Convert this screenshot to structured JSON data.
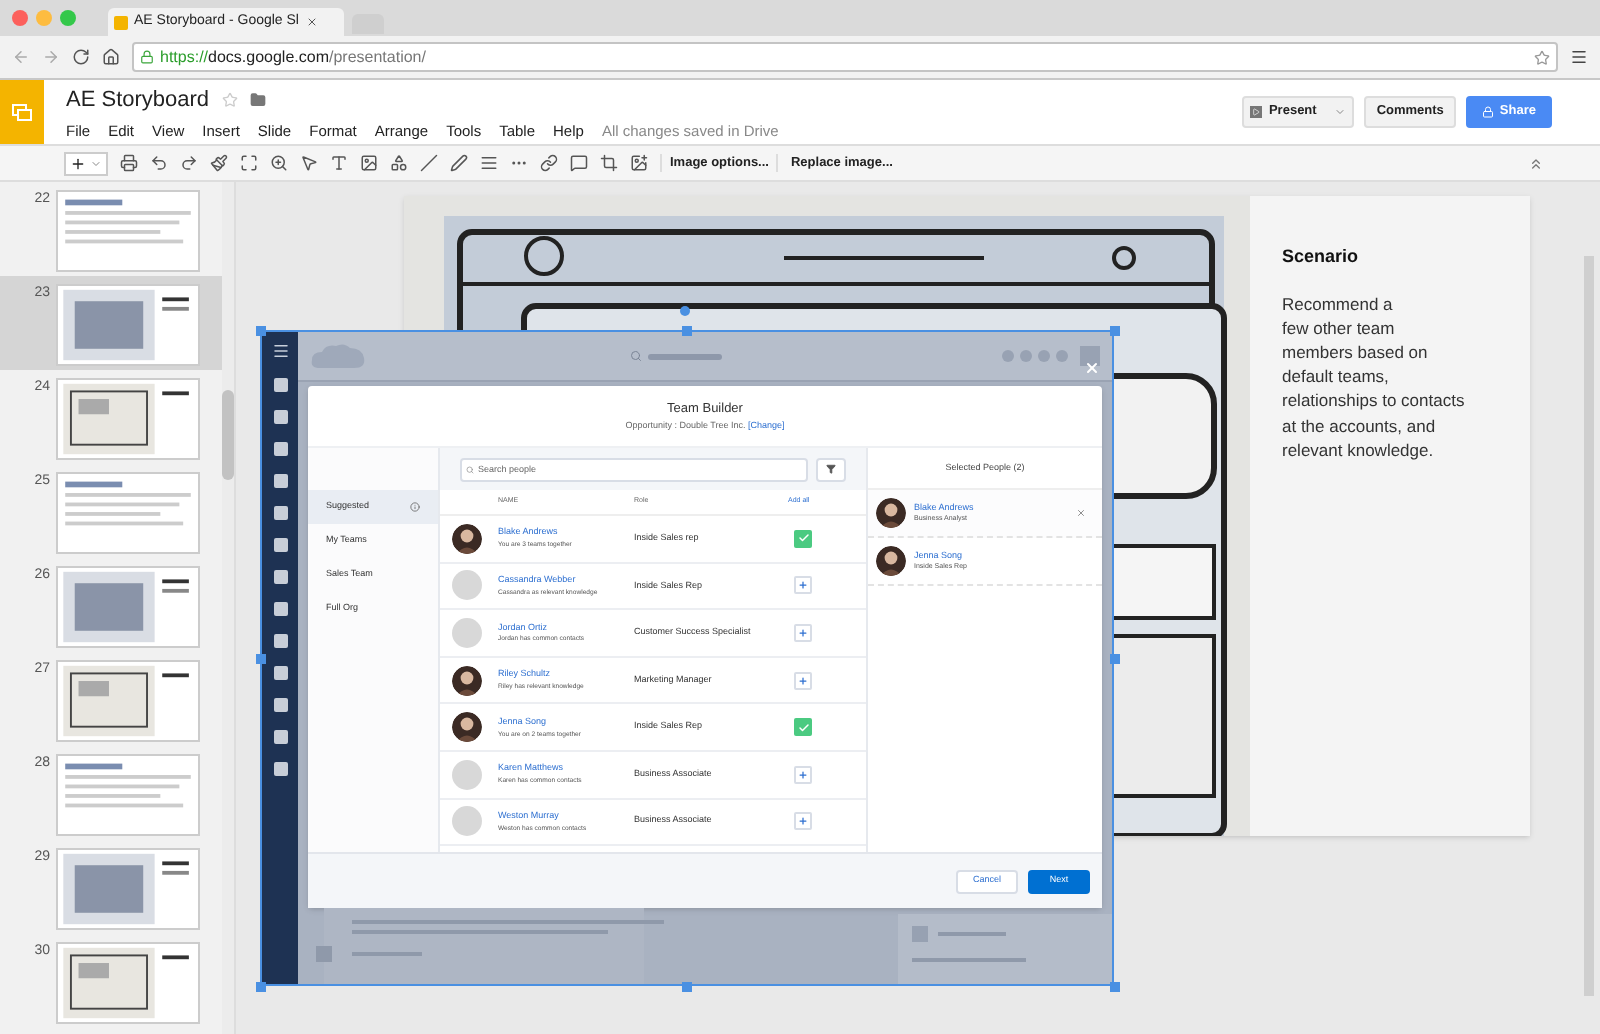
{
  "browser": {
    "tab_title": "AE Storyboard - Google Sl",
    "url_scheme": "https://",
    "url_host": "docs.google.com",
    "url_path": "/presentation/"
  },
  "document": {
    "title": "AE Storyboard",
    "menu": [
      "File",
      "Edit",
      "View",
      "Insert",
      "Slide",
      "Format",
      "Arrange",
      "Tools",
      "Table",
      "Help"
    ],
    "save_status": "All changes saved in Drive"
  },
  "header_buttons": {
    "present": "Present",
    "comments": "Comments",
    "share": "Share"
  },
  "toolbar": {
    "image_options": "Image options...",
    "replace_image": "Replace image..."
  },
  "slides": [
    {
      "number": "22",
      "selected": false
    },
    {
      "number": "23",
      "selected": true
    },
    {
      "number": "24",
      "selected": false
    },
    {
      "number": "25",
      "selected": false
    },
    {
      "number": "26",
      "selected": false
    },
    {
      "number": "27",
      "selected": false
    },
    {
      "number": "28",
      "selected": false
    },
    {
      "number": "29",
      "selected": false
    },
    {
      "number": "30",
      "selected": false
    }
  ],
  "slide": {
    "heading": "Scenario",
    "body_lines": [
      "Recommend a",
      "few other team",
      "members based on",
      "default teams,",
      "relationships to contacts",
      "at the accounts, and",
      "relevant knowledge."
    ]
  },
  "mockup": {
    "title": "Team Builder",
    "subtitle": "Opportunity : Double Tree Inc.",
    "change_link": "[Change]",
    "nav": [
      {
        "label": "Suggested",
        "selected": true
      },
      {
        "label": "My Teams",
        "selected": false
      },
      {
        "label": "Sales Team",
        "selected": false
      },
      {
        "label": "Full Org",
        "selected": false
      }
    ],
    "search_placeholder": "Search people",
    "columns": [
      "NAME",
      "Role",
      "Add all"
    ],
    "people": [
      {
        "name": "Blake Andrews",
        "note": "You are 3 teams together",
        "role": "Inside Sales rep",
        "added": true
      },
      {
        "name": "Cassandra Webber",
        "note": "Cassandra as relevant knowledge",
        "role": "Inside Sales Rep",
        "added": false,
        "kind": "placeholder"
      },
      {
        "name": "Jordan Ortiz",
        "note": "Jordan has common contacts",
        "role": "Customer Success Specialist",
        "added": false,
        "kind": "placeholder"
      },
      {
        "name": "Riley Schultz",
        "note": "Riley has relevant knowledge",
        "role": "Marketing Manager",
        "added": false
      },
      {
        "name": "Jenna Song",
        "note": "You are on 2 teams together",
        "role": "Inside Sales Rep",
        "added": true
      },
      {
        "name": "Karen Matthews",
        "note": "Karen has common contacts",
        "role": "Business Associate",
        "added": false,
        "kind": "placeholder"
      },
      {
        "name": "Weston Murray",
        "note": "Weston has common contacts",
        "role": "Business Associate",
        "added": false,
        "kind": "placeholder"
      }
    ],
    "selected_title": "Selected People (2)",
    "selected_people": [
      {
        "name": "Blake Andrews",
        "role": "Business Analyst",
        "hovered": true
      },
      {
        "name": "Jenna Song",
        "role": "Inside Sales Rep",
        "hovered": false
      }
    ],
    "cancel": "Cancel",
    "next": "Next"
  }
}
